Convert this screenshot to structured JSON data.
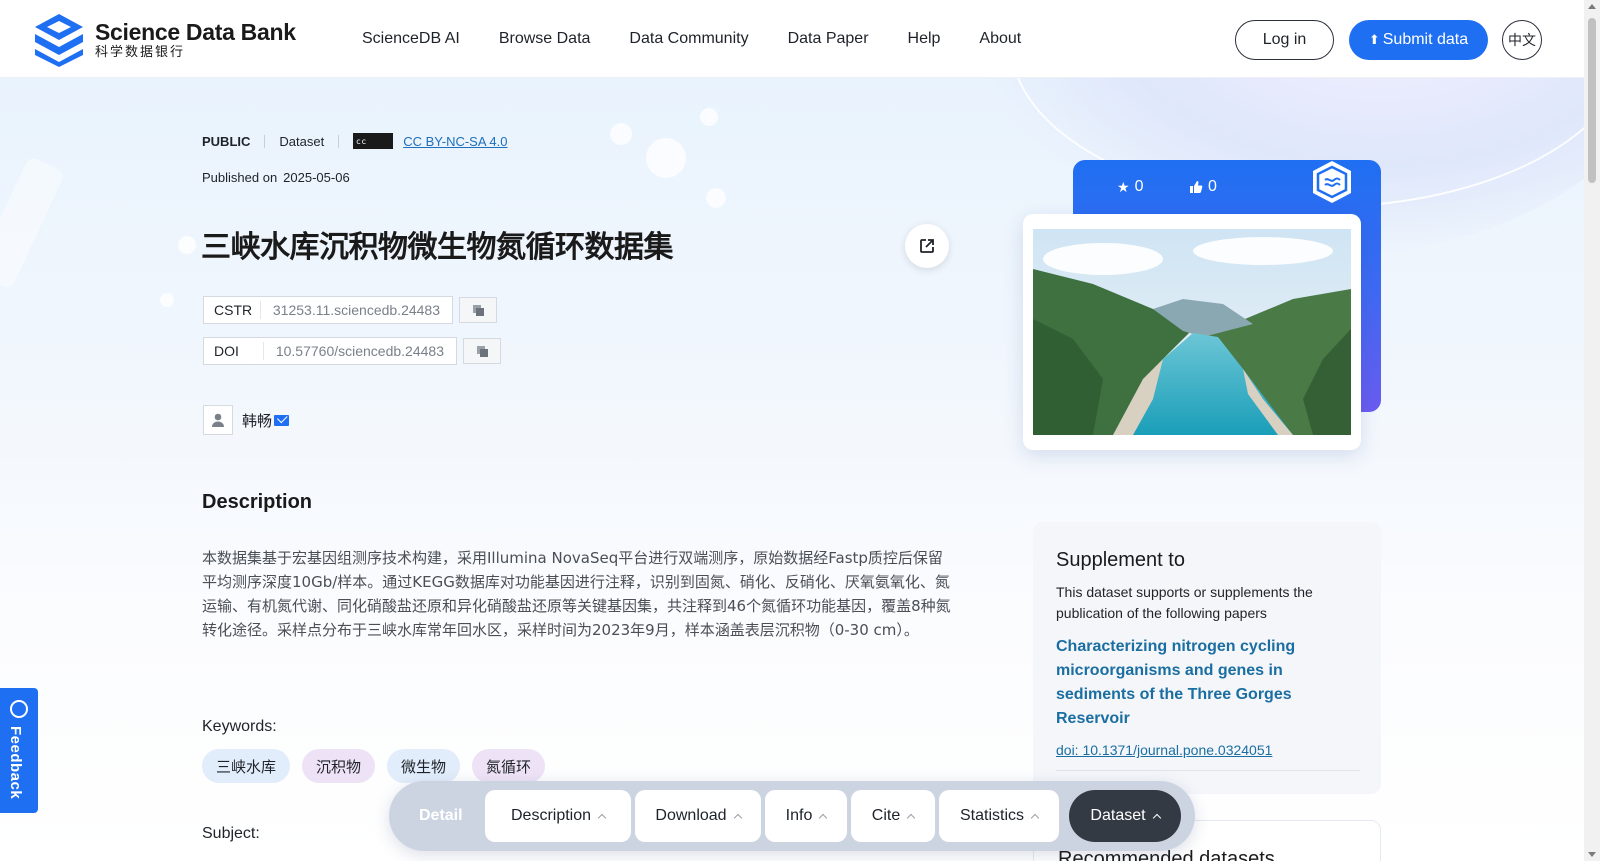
{
  "header": {
    "logo_title": "Science Data Bank",
    "logo_sub": "科学数据银行",
    "nav": [
      "ScienceDB AI",
      "Browse Data",
      "Data Community",
      "Data Paper",
      "Help",
      "About"
    ],
    "login_label": "Log in",
    "submit_label": "Submit data",
    "lang_label": "中文"
  },
  "meta": {
    "access": "PUBLIC",
    "type": "Dataset",
    "license": "CC BY-NC-SA 4.0",
    "cc_badge": "cc",
    "published_label": "Published on",
    "published_date": "2025-05-06"
  },
  "title": "三峡水库沉积物微生物氮循环数据集",
  "identifiers": {
    "cstr_label": "CSTR",
    "cstr_value": "31253.11.sciencedb.24483",
    "doi_label": "DOI",
    "doi_value": "10.57760/sciencedb.24483"
  },
  "author": {
    "name": "韩畅"
  },
  "description": {
    "heading": "Description",
    "text": "本数据集基于宏基因组测序技术构建，采用Illumina NovaSeq平台进行双端测序，原始数据经Fastp质控后保留平均测序深度10Gb/样本。通过KEGG数据库对功能基因进行注释，识别到固氮、硝化、反硝化、厌氧氨氧化、氮运输、有机氮代谢、同化硝酸盐还原和异化硝酸盐还原等关键基因集，共注释到46个氮循环功能基因，覆盖8种氮转化途径。采样点分布于三峡水库常年回水区，采样时间为2023年9月，样本涵盖表层沉积物（0-30 cm）。"
  },
  "keywords": {
    "label": "Keywords:",
    "items": [
      {
        "text": "三峡水库",
        "color": "#e2edfb"
      },
      {
        "text": "沉积物",
        "color": "#eee3f6"
      },
      {
        "text": "微生物",
        "color": "#e2edfb"
      },
      {
        "text": "氮循环",
        "color": "#eee3f6"
      }
    ]
  },
  "subject_label": "Subject:",
  "stats": {
    "stars": "0",
    "likes": "0"
  },
  "supplement": {
    "title": "Supplement to",
    "desc": "This dataset supports or supplements the publication of the following papers",
    "paper_title": "Characterizing nitrogen cycling microorganisms and genes in sediments of the Three Gorges Reservoir",
    "doi": "doi: 10.1371/journal.pone.0324051"
  },
  "recommended_title": "Recommended datasets",
  "feedback_label": "Feedback",
  "tabbar": {
    "detail": "Detail",
    "tabs": [
      "Description",
      "Download",
      "Info",
      "Cite",
      "Statistics",
      "Dataset"
    ]
  },
  "colors": {
    "primary": "#1f6ff2",
    "link": "#1b6ea1",
    "dark_tab": "#343a44"
  }
}
